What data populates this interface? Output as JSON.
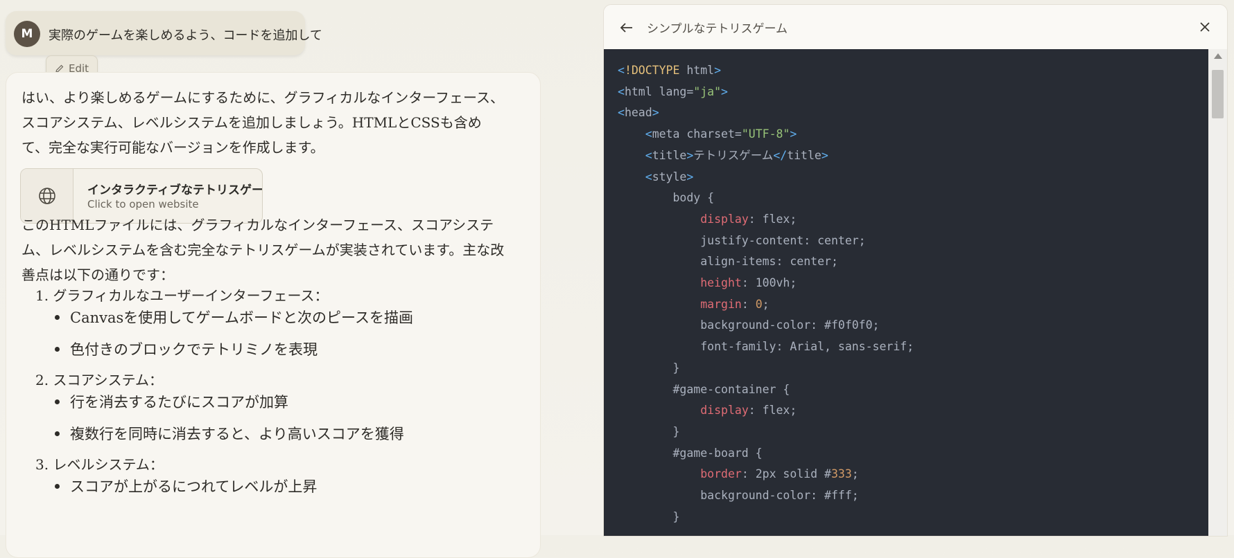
{
  "user_message": {
    "avatar_initial": "M",
    "text": "実際のゲームを楽しめるよう、コードを追加して",
    "edit_label": "Edit"
  },
  "assistant": {
    "intro": "はい、より楽しめるゲームにするために、グラフィカルなインターフェース、スコアシステム、レベルシステムを追加しましょう。HTMLとCSSも含めて、完全な実行可能なバージョンを作成します。",
    "artifact": {
      "icon": "globe-icon",
      "title": "インタラクティブなテトリスゲーム",
      "subtitle": "Click to open website"
    },
    "summary": "このHTMLファイルには、グラフィカルなインターフェース、スコアシステム、レベルシステムを含む完全なテトリスゲームが実装されています。主な改善点は以下の通りです：",
    "list": [
      {
        "label": "1. グラフィカルなユーザーインターフェース：",
        "bullets": [
          "Canvasを使用してゲームボードと次のピースを描画",
          "色付きのブロックでテトリミノを表現"
        ]
      },
      {
        "label": "2. スコアシステム：",
        "bullets": [
          "行を消去するたびにスコアが加算",
          "複数行を同時に消去すると、より高いスコアを獲得"
        ]
      },
      {
        "label": "3. レベルシステム：",
        "bullets": [
          "スコアが上がるにつれてレベルが上昇"
        ]
      }
    ]
  },
  "panel": {
    "title": "シンプルなテトリスゲーム",
    "code_lines": [
      [
        {
          "t": "<",
          "c": "bracket"
        },
        {
          "t": "!DOCTYPE",
          "c": "tag"
        },
        {
          "t": " html",
          "c": "text"
        },
        {
          "t": ">",
          "c": "bracket"
        }
      ],
      [
        {
          "t": "<",
          "c": "bracket"
        },
        {
          "t": "html",
          "c": "text"
        },
        {
          "t": " lang=",
          "c": "text"
        },
        {
          "t": "\"ja\"",
          "c": "str"
        },
        {
          "t": ">",
          "c": "bracket"
        }
      ],
      [
        {
          "t": "<",
          "c": "bracket"
        },
        {
          "t": "head",
          "c": "text"
        },
        {
          "t": ">",
          "c": "bracket"
        }
      ],
      [
        {
          "t": "    ",
          "c": "text"
        },
        {
          "t": "<",
          "c": "bracket"
        },
        {
          "t": "meta charset=",
          "c": "text"
        },
        {
          "t": "\"UTF-8\"",
          "c": "str"
        },
        {
          "t": ">",
          "c": "bracket"
        }
      ],
      [
        {
          "t": "    ",
          "c": "text"
        },
        {
          "t": "<",
          "c": "bracket"
        },
        {
          "t": "title",
          "c": "text"
        },
        {
          "t": ">",
          "c": "bracket"
        },
        {
          "t": "テトリスゲーム",
          "c": "text"
        },
        {
          "t": "</",
          "c": "bracket"
        },
        {
          "t": "title",
          "c": "text"
        },
        {
          "t": ">",
          "c": "bracket"
        }
      ],
      [
        {
          "t": "    ",
          "c": "text"
        },
        {
          "t": "<",
          "c": "bracket"
        },
        {
          "t": "style",
          "c": "text"
        },
        {
          "t": ">",
          "c": "bracket"
        }
      ],
      [
        {
          "t": "        body {",
          "c": "text"
        }
      ],
      [
        {
          "t": "            ",
          "c": "text"
        },
        {
          "t": "display",
          "c": "prop"
        },
        {
          "t": ": flex;",
          "c": "text"
        }
      ],
      [
        {
          "t": "            justify-content: center;",
          "c": "text"
        }
      ],
      [
        {
          "t": "            align-items: center;",
          "c": "text"
        }
      ],
      [
        {
          "t": "            ",
          "c": "text"
        },
        {
          "t": "height",
          "c": "prop"
        },
        {
          "t": ": 100vh;",
          "c": "text"
        }
      ],
      [
        {
          "t": "            ",
          "c": "text"
        },
        {
          "t": "margin",
          "c": "prop"
        },
        {
          "t": ": ",
          "c": "text"
        },
        {
          "t": "0",
          "c": "num"
        },
        {
          "t": ";",
          "c": "text"
        }
      ],
      [
        {
          "t": "            background-color: #f0f0f0;",
          "c": "text"
        }
      ],
      [
        {
          "t": "            font-family: Arial, sans-serif;",
          "c": "text"
        }
      ],
      [
        {
          "t": "        }",
          "c": "text"
        }
      ],
      [
        {
          "t": "        #game-container {",
          "c": "text"
        }
      ],
      [
        {
          "t": "            ",
          "c": "text"
        },
        {
          "t": "display",
          "c": "prop"
        },
        {
          "t": ": flex;",
          "c": "text"
        }
      ],
      [
        {
          "t": "        }",
          "c": "text"
        }
      ],
      [
        {
          "t": "        #game-board {",
          "c": "text"
        }
      ],
      [
        {
          "t": "            ",
          "c": "text"
        },
        {
          "t": "border",
          "c": "prop"
        },
        {
          "t": ": 2px solid #",
          "c": "text"
        },
        {
          "t": "333",
          "c": "num"
        },
        {
          "t": ";",
          "c": "text"
        }
      ],
      [
        {
          "t": "            background-color: #fff;",
          "c": "text"
        }
      ],
      [
        {
          "t": "        }",
          "c": "text"
        }
      ]
    ]
  }
}
